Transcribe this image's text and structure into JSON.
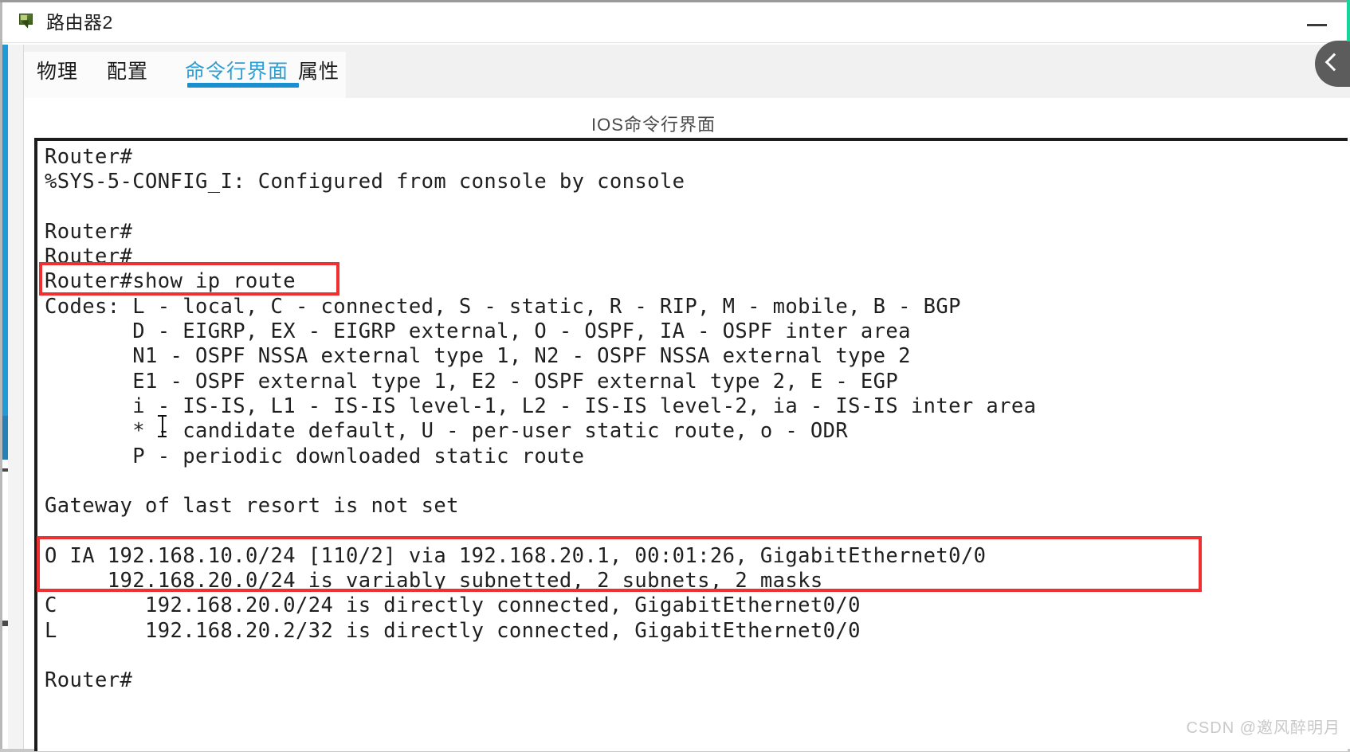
{
  "window": {
    "title": "路由器2",
    "icon": "router-icon",
    "minimize_label": "—"
  },
  "tabs": [
    {
      "label": "物理",
      "active": false
    },
    {
      "label": "配置",
      "active": false
    },
    {
      "label": "命令行界面",
      "active": true
    },
    {
      "label": "属性",
      "active": false
    }
  ],
  "side_handle": {
    "icon": "chevron-left-icon",
    "accent_color": "#19d39a"
  },
  "content": {
    "heading": "IOS命令行界面"
  },
  "terminal": {
    "font_color": "#1f1f1f",
    "background": "#ffffff",
    "lines": [
      "Router#",
      "%SYS-5-CONFIG_I: Configured from console by console",
      "",
      "Router#",
      "Router#",
      "Router#show ip route",
      "Codes: L - local, C - connected, S - static, R - RIP, M - mobile, B - BGP",
      "       D - EIGRP, EX - EIGRP external, O - OSPF, IA - OSPF inter area",
      "       N1 - OSPF NSSA external type 1, N2 - OSPF NSSA external type 2",
      "       E1 - OSPF external type 1, E2 - OSPF external type 2, E - EGP",
      "       i - IS-IS, L1 - IS-IS level-1, L2 - IS-IS level-2, ia - IS-IS inter area",
      "       * - candidate default, U - per-user static route, o - ODR",
      "       P - periodic downloaded static route",
      "",
      "Gateway of last resort is not set",
      "",
      "O IA 192.168.10.0/24 [110/2] via 192.168.20.1, 00:01:26, GigabitEthernet0/0",
      "     192.168.20.0/24 is variably subnetted, 2 subnets, 2 masks",
      "C       192.168.20.0/24 is directly connected, GigabitEthernet0/0",
      "L       192.168.20.2/32 is directly connected, GigabitEthernet0/0",
      "",
      "Router#"
    ],
    "text": "Router#\n%SYS-5-CONFIG_I: Configured from console by console\n\nRouter#\nRouter#\nRouter#show ip route\nCodes: L - local, C - connected, S - static, R - RIP, M - mobile, B - BGP\n       D - EIGRP, EX - EIGRP external, O - OSPF, IA - OSPF inter area\n       N1 - OSPF NSSA external type 1, N2 - OSPF NSSA external type 2\n       E1 - OSPF external type 1, E2 - OSPF external type 2, E - EGP\n       i - IS-IS, L1 - IS-IS level-1, L2 - IS-IS level-2, ia - IS-IS inter area\n       * - candidate default, U - per-user static route, o - ODR\n       P - periodic downloaded static route\n\nGateway of last resort is not set\n\nO IA 192.168.10.0/24 [110/2] via 192.168.20.1, 00:01:26, GigabitEthernet0/0\n     192.168.20.0/24 is variably subnetted, 2 subnets, 2 masks\nC       192.168.20.0/24 is directly connected, GigabitEthernet0/0\nL       192.168.20.2/32 is directly connected, GigabitEthernet0/0\n\nRouter#"
  },
  "annotations": {
    "color": "#f03030",
    "boxes": [
      {
        "name": "command-highlight",
        "target": "Router#show ip route"
      },
      {
        "name": "route-highlight",
        "target": "O IA 192.168.10.0/24 [110/2] via 192.168.20.1, 00:01:26, GigabitEthernet0/0 / 192.168.20.0/24 is variably subnetted, 2 subnets, 2 masks"
      }
    ]
  },
  "watermark": {
    "text": "CSDN @邀风醉明月"
  }
}
